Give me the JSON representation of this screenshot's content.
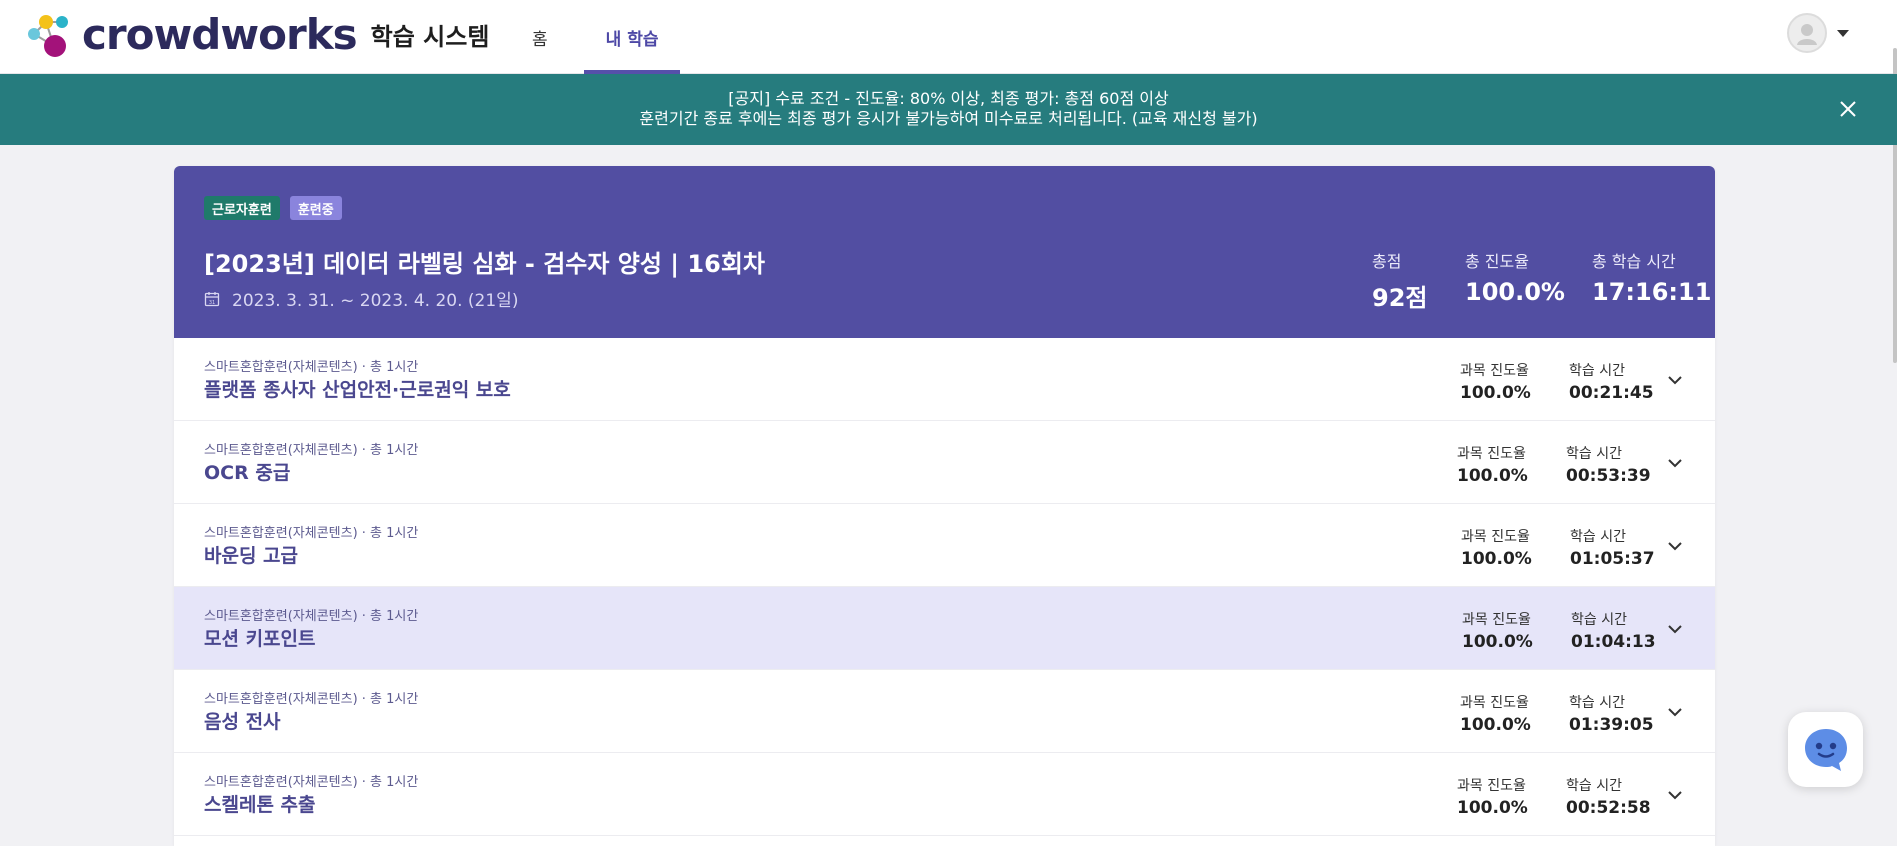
{
  "header": {
    "logo_text": "crowdworks",
    "logo_sub": "학습 시스템",
    "nav": [
      {
        "label": "홈"
      },
      {
        "label": "내 학습"
      }
    ]
  },
  "notice": {
    "line1": "[공지] 수료 조건 - 진도율: 80% 이상, 최종 평가: 총점 60점 이상",
    "line2": "훈련기간 종료 후에는 최종 평가 응시가 불가능하여 미수료로 처리됩니다. (교육 재신청 불가)"
  },
  "course": {
    "badges": [
      "근로자훈련",
      "훈련중"
    ],
    "title": "[2023년] 데이터 라벨링 심화 - 검수자 양성 | 16회차",
    "date": "2023. 3. 31. ~ 2023. 4. 20. (21일)",
    "stats": {
      "score_label": "총점",
      "score_value": "92점",
      "progress_label": "총 진도율",
      "progress_value": "100.0%",
      "time_label": "총 학습 시간",
      "time_value": "17:16:11"
    }
  },
  "row_labels": {
    "progress": "과목 진도율",
    "time": "학습 시간"
  },
  "subjects": [
    {
      "meta": "스마트혼합훈련(자체콘텐츠) · 총 1시간",
      "name": "플랫폼 종사자 산업안전·근로권익 보호",
      "progress": "100.0%",
      "time": "00:21:45"
    },
    {
      "meta": "스마트혼합훈련(자체콘텐츠) · 총 1시간",
      "name": "OCR 중급",
      "progress": "100.0%",
      "time": "00:53:39"
    },
    {
      "meta": "스마트혼합훈련(자체콘텐츠) · 총 1시간",
      "name": "바운딩 고급",
      "progress": "100.0%",
      "time": "01:05:37"
    },
    {
      "meta": "스마트혼합훈련(자체콘텐츠) · 총 1시간",
      "name": "모션 키포인트",
      "progress": "100.0%",
      "time": "01:04:13"
    },
    {
      "meta": "스마트혼합훈련(자체콘텐츠) · 총 1시간",
      "name": "음성 전사",
      "progress": "100.0%",
      "time": "01:39:05"
    },
    {
      "meta": "스마트혼합훈련(자체콘텐츠) · 총 1시간",
      "name": "스켈레톤 추출",
      "progress": "100.0%",
      "time": "00:52:58"
    }
  ],
  "colors": {
    "brand": "#524ea2",
    "notice": "#267c7e",
    "highlight": "#e6e5f9"
  }
}
